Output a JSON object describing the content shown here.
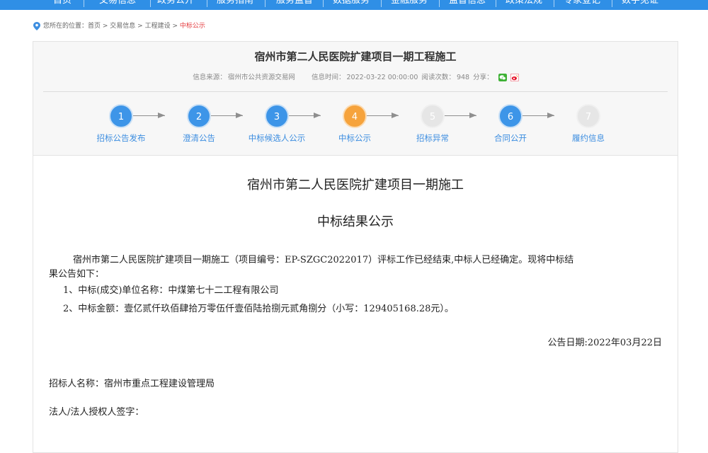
{
  "nav": {
    "items": [
      "首页",
      "交易信息",
      "政务公开",
      "服务指南",
      "服务监督",
      "数据服务",
      "金融服务",
      "监督信息",
      "政策法规",
      "专家登记",
      "数字见证"
    ]
  },
  "breadcrumb": {
    "prefix": "您所在的位置：",
    "items": [
      "首页",
      "交易信息",
      "工程建设"
    ],
    "separator": " > ",
    "current": "中标公示"
  },
  "header": {
    "title": "宿州市第二人民医院扩建项目一期工程施工",
    "source_label": "信息来源：",
    "source_value": "宿州市公共资源交易网",
    "time_label": "信息时间：",
    "time_value": "2022-03-22 00:00:00",
    "views_label": "阅读次数：",
    "views_value": "948",
    "share_label": "分享：",
    "share_icons": [
      "wechat-icon",
      "weibo-icon"
    ]
  },
  "steps": [
    {
      "number": "1",
      "label": "招标公告发布",
      "state": "done"
    },
    {
      "number": "2",
      "label": "澄清公告",
      "state": "done"
    },
    {
      "number": "3",
      "label": "中标候选人公示",
      "state": "done"
    },
    {
      "number": "4",
      "label": "中标公示",
      "state": "current"
    },
    {
      "number": "5",
      "label": "招标异常",
      "state": "inactive"
    },
    {
      "number": "6",
      "label": "合同公开",
      "state": "done"
    },
    {
      "number": "7",
      "label": "履约信息",
      "state": "inactive"
    }
  ],
  "colors": {
    "nav_bg": "#2f8fe6",
    "step_done": "#3d95e8",
    "step_current": "#f6a33c",
    "step_inactive": "#e6e6e6",
    "breadcrumb_current": "#e4393c"
  },
  "document": {
    "title": "宿州市第二人民医院扩建项目一期施工",
    "subtitle": "中标结果公示",
    "intro_line1": "宿州市第二人民医院扩建项目一期施工（项目编号：EP-SZGC2022017）评标工作已经结束,中标人已经确定。现将中标结",
    "intro_line2": "果公告如下：",
    "item1": "1、中标(成交)单位名称：中煤第七十二工程有限公司",
    "item2": "2、中标金额：壹亿贰仟玖佰肆拾万零伍仟壹佰陆拾捌元贰角捌分（小写：129405168.28元）。",
    "announce_date": "公告日期:2022年03月22日",
    "tenderer": "招标人名称：宿州市重点工程建设管理局",
    "signature": "法人/法人授权人签字："
  }
}
